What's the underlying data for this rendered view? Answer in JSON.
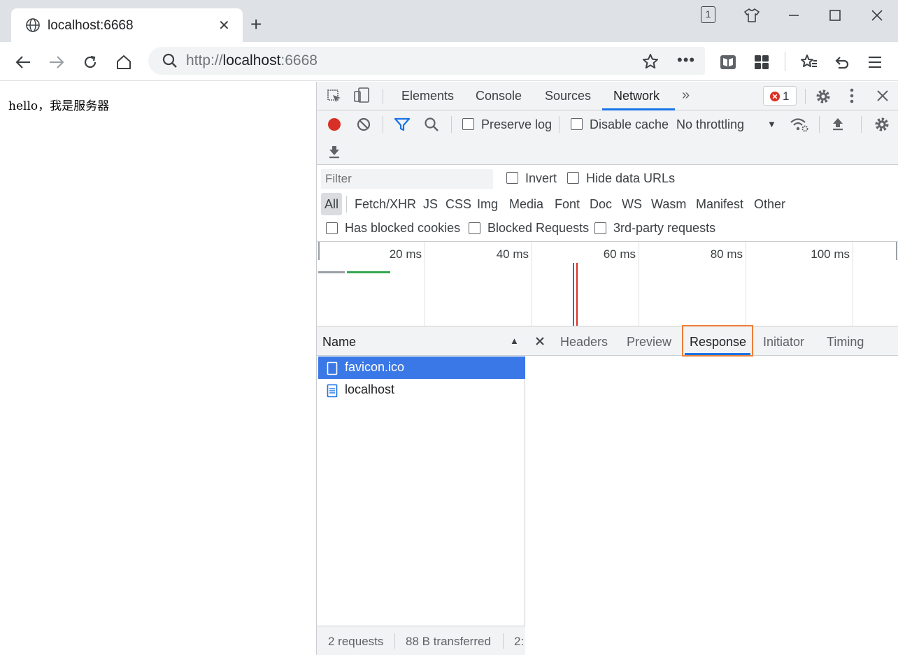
{
  "browser": {
    "tab_title": "localhost:6668",
    "window_badge": "1",
    "url_scheme": "http://",
    "url_host": "localhost",
    "url_port": ":6668"
  },
  "page": {
    "content_text": "hello，我是服务器"
  },
  "devtools": {
    "tabs": [
      {
        "label": "Elements",
        "active": false
      },
      {
        "label": "Console",
        "active": false
      },
      {
        "label": "Sources",
        "active": false
      },
      {
        "label": "Network",
        "active": true
      }
    ],
    "error_count": "1",
    "network_toolbar": {
      "preserve_log": "Preserve log",
      "disable_cache": "Disable cache",
      "throttling": "No throttling"
    },
    "filter": {
      "placeholder": "Filter",
      "invert": "Invert",
      "hide_data_urls": "Hide data URLs",
      "types": [
        "All",
        "Fetch/XHR",
        "JS",
        "CSS",
        "Img",
        "Media",
        "Font",
        "Doc",
        "WS",
        "Wasm",
        "Manifest",
        "Other"
      ],
      "has_blocked_cookies": "Has blocked cookies",
      "blocked_requests": "Blocked Requests",
      "third_party": "3rd-party requests"
    },
    "timeline": {
      "ticks": [
        "20 ms",
        "40 ms",
        "60 ms",
        "80 ms",
        "100 ms"
      ]
    },
    "requests": {
      "header_name": "Name",
      "rows": [
        {
          "name": "favicon.ico",
          "selected": true
        },
        {
          "name": "localhost",
          "selected": false
        }
      ],
      "status_requests": "2 requests",
      "status_transferred": "88 B transferred",
      "status_more": "2:"
    },
    "detail_tabs": [
      {
        "label": "Headers",
        "active": false
      },
      {
        "label": "Preview",
        "active": false
      },
      {
        "label": "Response",
        "active": true
      },
      {
        "label": "Initiator",
        "active": false
      },
      {
        "label": "Timing",
        "active": false
      }
    ]
  },
  "colors": {
    "accent": "#1a73e8",
    "record": "#d93025",
    "highlight": "#e9803a",
    "selected_row": "#3b78e7"
  }
}
